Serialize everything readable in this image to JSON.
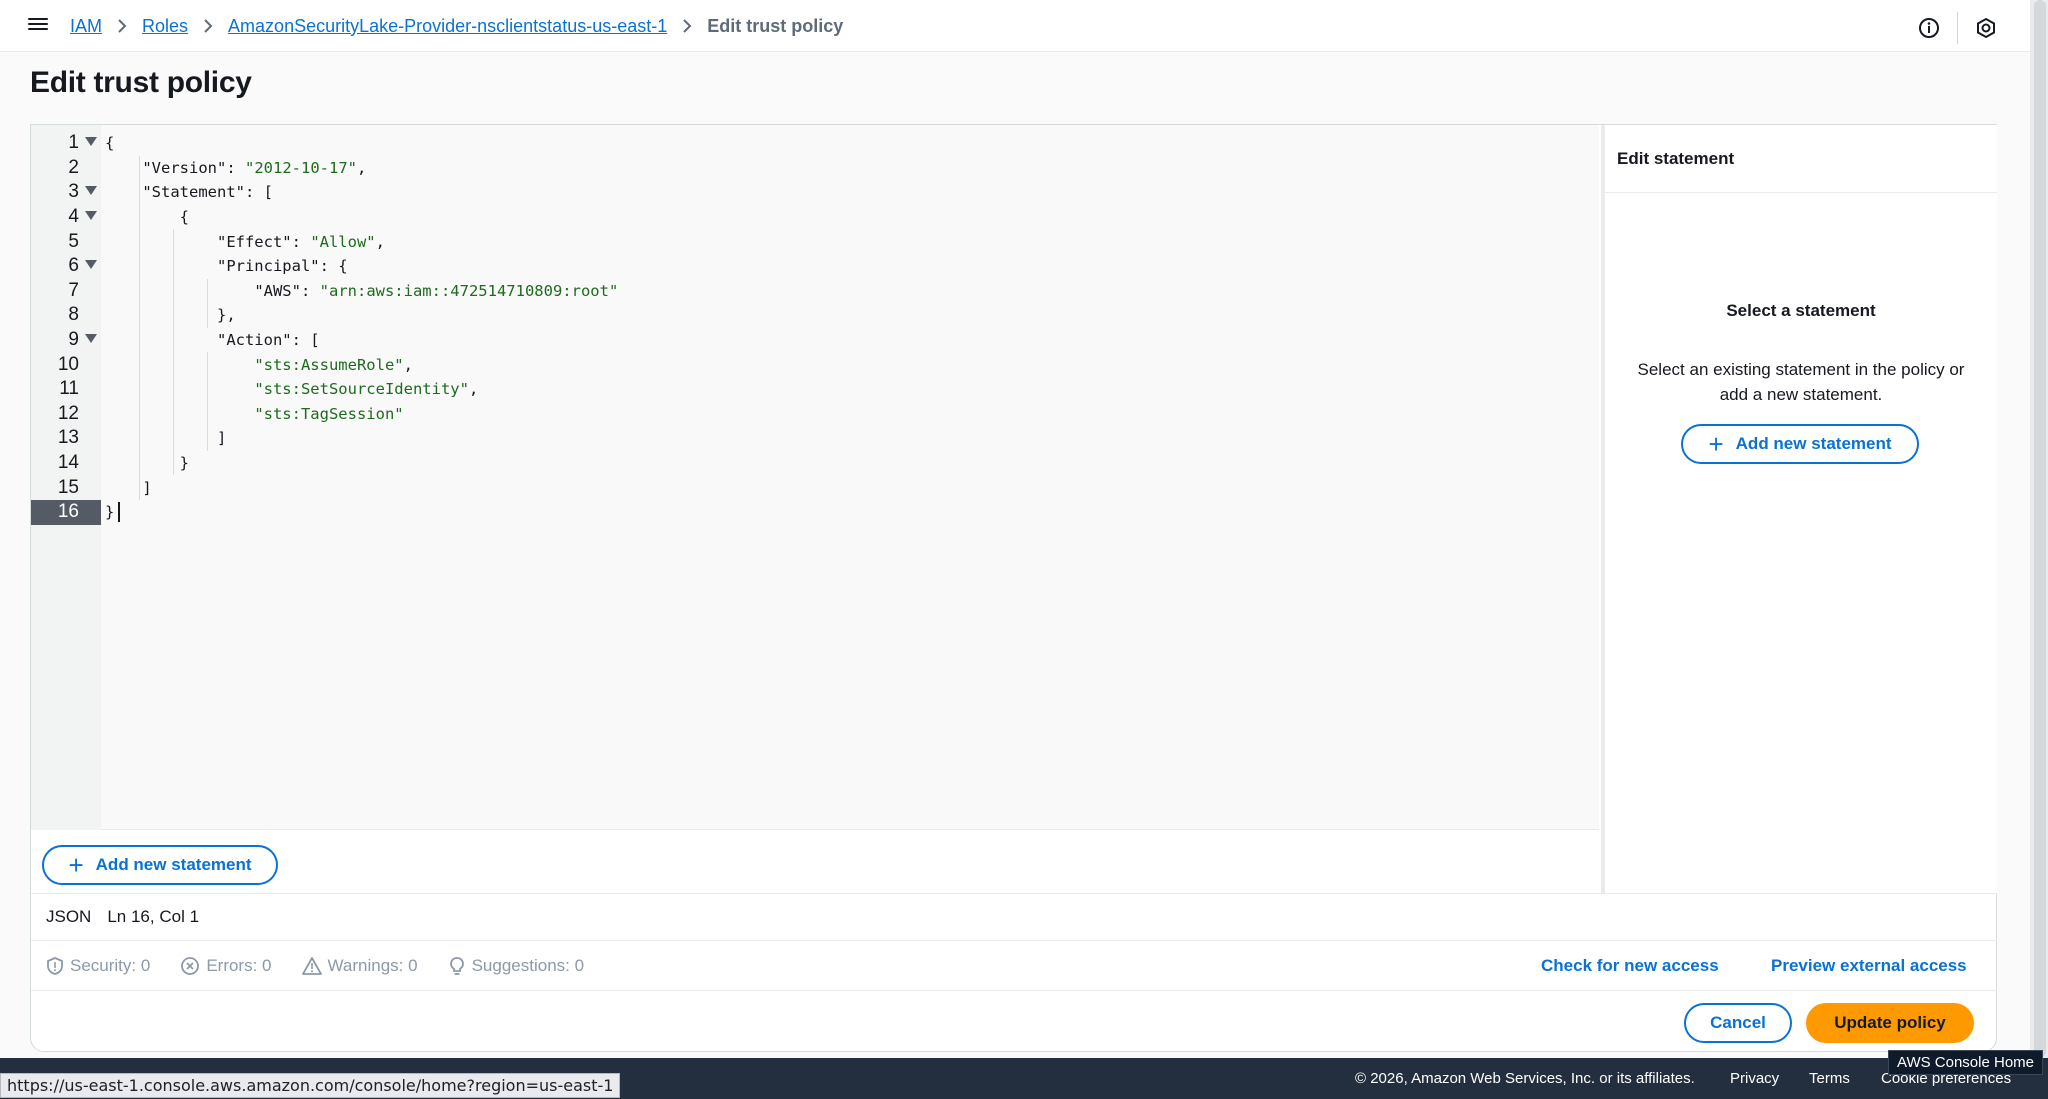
{
  "breadcrumb": {
    "items": [
      "IAM",
      "Roles",
      "AmazonSecurityLake-Provider-nsclientstatus-us-east-1"
    ],
    "current": "Edit trust policy"
  },
  "page": {
    "title": "Edit trust policy"
  },
  "editor": {
    "line_numbers": [
      "1",
      "2",
      "3",
      "4",
      "5",
      "6",
      "7",
      "8",
      "9",
      "10",
      "11",
      "12",
      "13",
      "14",
      "15",
      "16"
    ],
    "lines": [
      "{",
      "    \"Version\": \"2012-10-17\",",
      "    \"Statement\": [",
      "        {",
      "            \"Effect\": \"Allow\",",
      "            \"Principal\": {",
      "                \"AWS\": \"arn:aws:iam::472514710809:root\"",
      "            },",
      "            \"Action\": [",
      "                \"sts:AssumeRole\",",
      "                \"sts:SetSourceIdentity\",",
      "                \"sts:TagSession\"",
      "            ]",
      "        }",
      "    ]",
      "}"
    ],
    "active_line": 16,
    "add_statement_label": "Add new statement"
  },
  "status": {
    "language": "JSON",
    "position": "Ln 16, Col 1"
  },
  "checks": {
    "security": "Security: 0",
    "errors": "Errors: 0",
    "warnings": "Warnings: 0",
    "suggestions": "Suggestions: 0",
    "check_access_label": "Check for new access",
    "preview_access_label": "Preview external access"
  },
  "right_panel": {
    "header": "Edit statement",
    "title": "Select a statement",
    "description": "Select an existing statement in the policy or add a new statement.",
    "add_statement_label": "Add new statement"
  },
  "actions": {
    "cancel_label": "Cancel",
    "update_label": "Update policy"
  },
  "footer": {
    "copyright": "© 2026, Amazon Web Services, Inc. or its affiliates.",
    "privacy": "Privacy",
    "terms": "Terms",
    "cookies": "Cookie preferences"
  },
  "tooltips": {
    "url": "https://us-east-1.console.aws.amazon.com/console/home?region=us-east-1",
    "home": "AWS Console Home"
  },
  "icons": [
    "menu-icon",
    "info-icon",
    "settings-icon",
    "fold-arrow-icon",
    "plus-icon",
    "shield-icon",
    "error-icon",
    "warning-icon",
    "lightbulb-icon"
  ],
  "colors": {
    "link": "#0972d3",
    "primary_button": "#ff9900",
    "footer_bg": "#232f3e"
  }
}
